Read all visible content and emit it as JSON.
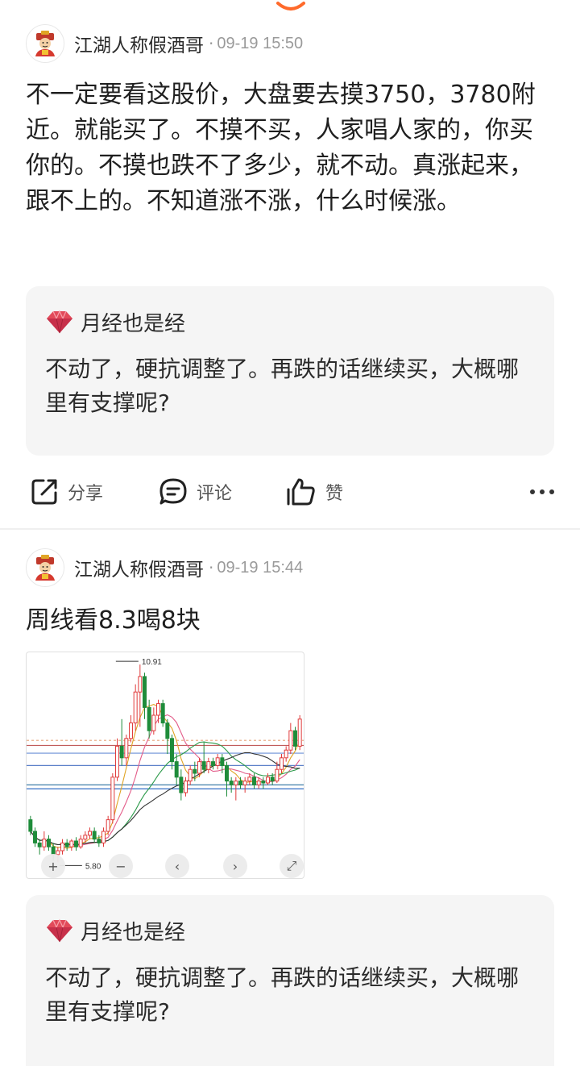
{
  "posts": [
    {
      "author": "江湖人称假酒哥",
      "separator": "·",
      "time": "09-19 15:50",
      "content": "不一定要看这股价，大盘要去摸3750，3780附近。就能买了。不摸不买，人家唱人家的，你买你的。不摸也跌不了多少，就不动。真涨起来，跟不上的。不知道涨不涨，什么时候涨。",
      "quote": {
        "author": "月经也是经",
        "text": "不动了，硬抗调整了。再跌的话继续买，大概哪里有支撑呢?"
      },
      "actions": {
        "share": "分享",
        "comment": "评论",
        "like": "赞"
      }
    },
    {
      "author": "江湖人称假酒哥",
      "separator": "·",
      "time": "09-19 15:44",
      "content": "周线看8.3喝8块",
      "chart": {
        "high_label": "10.91",
        "low_label": "5.80",
        "controls": [
          "+",
          "−",
          "‹",
          "›",
          "⤢"
        ]
      },
      "quote": {
        "author": "月经也是经",
        "text": "不动了，硬抗调整了。再跌的话继续买，大概哪里有支撑呢?"
      }
    }
  ],
  "icons": {
    "share": "share-icon",
    "comment": "comment-icon",
    "like": "thumbs-up-icon",
    "more": "more-icon",
    "avatar": "fortune-god-avatar",
    "quote_badge": "red-gem-icon"
  },
  "colors": {
    "accent_orange": "#ff6a2b",
    "candle_up": "#e03b3b",
    "candle_down": "#1e8c3a",
    "quote_bg": "#f5f5f5"
  },
  "chart_data": {
    "type": "candlestick",
    "price_labels": {
      "high": "10.91",
      "low": "5.80"
    },
    "candles": [
      [
        6.9,
        6.6,
        7.0,
        6.5
      ],
      [
        6.6,
        6.3,
        6.7,
        6.2
      ],
      [
        6.3,
        6.2,
        6.4,
        6.0
      ],
      [
        6.2,
        6.4,
        6.6,
        6.1
      ],
      [
        6.4,
        6.2,
        6.5,
        6.1
      ],
      [
        6.2,
        6.0,
        6.3,
        5.85
      ],
      [
        6.0,
        6.1,
        6.2,
        5.8
      ],
      [
        6.1,
        6.3,
        6.4,
        6.0
      ],
      [
        6.3,
        6.2,
        6.4,
        6.1
      ],
      [
        6.2,
        6.35,
        6.4,
        6.1
      ],
      [
        6.35,
        6.2,
        6.45,
        6.1
      ],
      [
        6.2,
        6.4,
        6.5,
        6.15
      ],
      [
        6.4,
        6.5,
        6.6,
        6.3
      ],
      [
        6.5,
        6.6,
        6.7,
        6.4
      ],
      [
        6.6,
        6.4,
        6.7,
        6.3
      ],
      [
        6.4,
        6.3,
        6.5,
        6.2
      ],
      [
        6.3,
        6.6,
        6.7,
        6.2
      ],
      [
        6.6,
        6.9,
        7.0,
        6.5
      ],
      [
        6.9,
        8.0,
        8.1,
        6.8
      ],
      [
        8.0,
        8.8,
        9.0,
        7.9
      ],
      [
        8.8,
        8.5,
        9.5,
        8.3
      ],
      [
        8.5,
        9.0,
        9.1,
        8.3
      ],
      [
        9.0,
        9.4,
        9.6,
        8.9
      ],
      [
        9.4,
        10.2,
        10.4,
        9.2
      ],
      [
        10.2,
        10.6,
        10.91,
        9.3
      ],
      [
        10.6,
        9.8,
        10.7,
        9.5
      ],
      [
        9.8,
        9.2,
        10.0,
        9.0
      ],
      [
        9.2,
        9.6,
        9.8,
        9.1
      ],
      [
        9.6,
        9.9,
        10.0,
        9.4
      ],
      [
        9.9,
        9.4,
        10.0,
        9.3
      ],
      [
        9.4,
        9.0,
        9.5,
        8.6
      ],
      [
        9.0,
        8.4,
        9.1,
        8.2
      ],
      [
        8.4,
        8.0,
        8.6,
        7.8
      ],
      [
        8.0,
        7.6,
        8.2,
        7.4
      ],
      [
        7.6,
        7.9,
        8.0,
        7.5
      ],
      [
        7.9,
        8.2,
        8.3,
        7.8
      ],
      [
        8.2,
        8.1,
        8.4,
        7.9
      ],
      [
        8.1,
        8.4,
        8.5,
        8.0
      ],
      [
        8.4,
        8.2,
        8.9,
        8.1
      ],
      [
        8.2,
        8.4,
        8.5,
        8.1
      ],
      [
        8.4,
        8.3,
        8.5,
        8.2
      ],
      [
        8.3,
        8.5,
        8.6,
        8.2
      ],
      [
        8.5,
        8.3,
        8.6,
        8.1
      ],
      [
        8.3,
        7.9,
        8.4,
        7.5
      ],
      [
        7.9,
        7.8,
        8.0,
        7.6
      ],
      [
        7.8,
        7.9,
        8.0,
        7.4
      ],
      [
        7.9,
        7.8,
        8.0,
        7.7
      ],
      [
        7.8,
        7.9,
        8.0,
        7.6
      ],
      [
        7.9,
        8.0,
        8.1,
        7.8
      ],
      [
        8.0,
        7.8,
        8.1,
        7.7
      ],
      [
        7.8,
        7.9,
        8.0,
        7.7
      ],
      [
        7.9,
        7.85,
        8.0,
        7.7
      ],
      [
        7.85,
        8.0,
        8.1,
        7.8
      ],
      [
        8.0,
        7.9,
        8.1,
        7.8
      ],
      [
        7.9,
        8.2,
        8.4,
        7.85
      ],
      [
        8.2,
        8.5,
        8.6,
        8.1
      ],
      [
        8.5,
        8.7,
        8.8,
        8.4
      ],
      [
        8.7,
        9.2,
        9.4,
        8.6
      ],
      [
        9.2,
        8.8,
        9.3,
        8.7
      ],
      [
        8.8,
        9.5,
        9.6,
        8.7
      ]
    ],
    "hlines": [
      {
        "value": 8.95,
        "color": "#e7a37a",
        "dashed": true
      },
      {
        "value": 8.82,
        "color": "#c15b5b"
      },
      {
        "value": 8.62,
        "color": "#6b8fd6"
      },
      {
        "value": 8.3,
        "color": "#5a7fc8"
      },
      {
        "value": 7.8,
        "color": "#3f7ea8"
      },
      {
        "value": 7.7,
        "color": "#1c5fbf"
      }
    ],
    "ylim": [
      5.6,
      11.1
    ]
  }
}
